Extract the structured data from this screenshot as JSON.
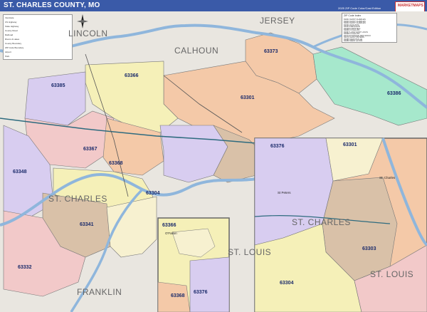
{
  "header": {
    "title": "ST. CHARLES COUNTY, MO",
    "edition": "2025 ZIP Code Color/Cast Edition",
    "brand": "MARKETMAPS"
  },
  "colors": {
    "title_bar": "#3a5aa8",
    "river": "#8fb6dc",
    "zip_purple": "#d8cdf0",
    "zip_pink": "#f2c9c9",
    "zip_yellow": "#f5f0b8",
    "zip_orange": "#f4c9a8",
    "zip_tan": "#d9c1a8",
    "zip_green": "#a6e8cc",
    "zip_cream": "#f7f1d0"
  },
  "counties": {
    "jersey": "JERSEY",
    "calhoun": "CALHOUN",
    "lincoln": "LINCOLN",
    "st_charles": "ST. CHARLES",
    "franklin": "FRANKLIN",
    "st_louis": "ST. LOUIS"
  },
  "zips": {
    "z63366": "63366",
    "z63373": "63373",
    "z63385": "63385",
    "z63301": "63301",
    "z63386": "63386",
    "z63367": "63367",
    "z63368": "63368",
    "z63348": "63348",
    "z63304": "63304",
    "z63341": "63341",
    "z63332": "63332",
    "z63376": "63376",
    "z63303": "63303"
  },
  "places": {
    "ofallon": "O'Fallon",
    "st_peters": "St Peters",
    "st_charles_city": "St. Charles"
  },
  "legend": {
    "items": [
      "Interstate",
      "US Highway",
      "State Highway",
      "County Road",
      "Railroad",
      "Rivers & Lakes",
      "County Boundary",
      "ZIP Code Boundary",
      "Airport",
      "Park"
    ]
  },
  "zip_table": {
    "header": "ZIP Code Index",
    "rows": [
      "63301 SAINT CHARLES",
      "63303 SAINT CHARLES",
      "63304 SAINT CHARLES",
      "63332 AUGUSTA",
      "63341 DEFIANCE",
      "63348 FORISTELL",
      "63366 O FALLON",
      "63367 LAKE SAINT LOUIS",
      "63368 O FALLON",
      "63373 PORTAGE DES SIOUX",
      "63376 SAINT PETERS",
      "63385 WENTZVILLE",
      "63386 WEST ALTON"
    ]
  }
}
